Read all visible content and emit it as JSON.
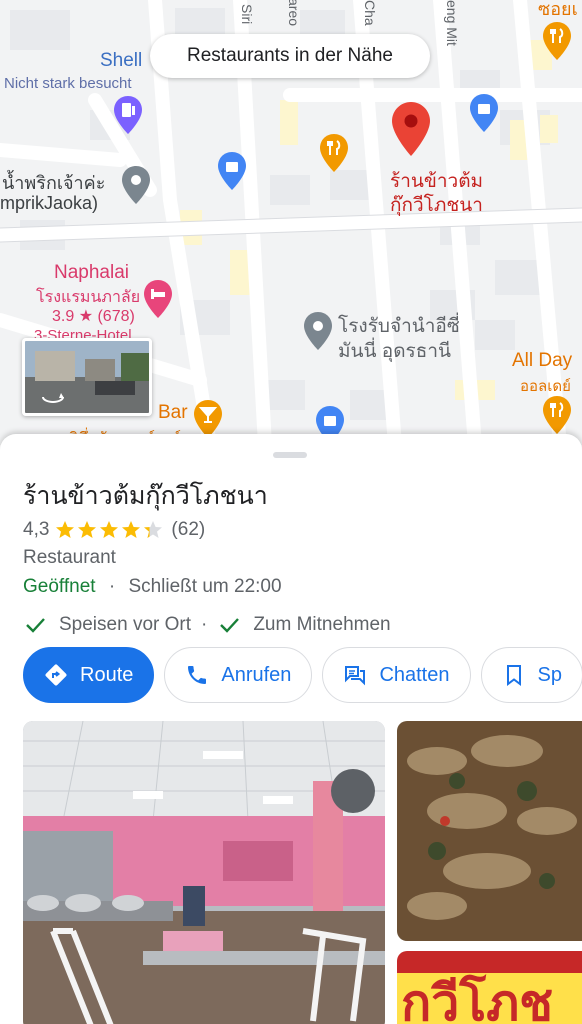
{
  "search": {
    "label": "Restaurants in der Nähe"
  },
  "map": {
    "streets": [
      "Siri",
      "areo",
      "Cha",
      "eng Mit"
    ],
    "labels": [
      {
        "key": "shell",
        "text": "Shell",
        "color": "#3b6fc2"
      },
      {
        "key": "busy",
        "text": "Nicht stark besucht",
        "color": "#5f6fa8"
      },
      {
        "key": "namprik1",
        "text": "น้ำพริกเจ้าค่ะ",
        "color": "#3c4043"
      },
      {
        "key": "namprik2",
        "text": "mprikJaoka)",
        "color": "#3c4043"
      },
      {
        "key": "selected1",
        "text": "ร้านข้าวต้ม",
        "color": "#c5221f"
      },
      {
        "key": "selected2",
        "text": "กุ๊กวีโภชนา",
        "color": "#c5221f"
      },
      {
        "key": "naphalai",
        "text": "Naphalai",
        "color": "#d93a6b"
      },
      {
        "key": "naphalaiThai",
        "text": "โรงแรมนภาลัย",
        "color": "#d93a6b"
      },
      {
        "key": "naphalaiRating",
        "text": "3.9 ★ (678)",
        "color": "#d93a6b"
      },
      {
        "key": "naphalaiStars",
        "text": "3-Sterne-Hotel",
        "color": "#d93a6b"
      },
      {
        "key": "pawn1",
        "text": "โรงรับจำนำอีซี่",
        "color": "#5f6368"
      },
      {
        "key": "pawn2",
        "text": "มันนี่ อุดรธานี",
        "color": "#5f6368"
      },
      {
        "key": "allday",
        "text": "All Day",
        "color": "#e37400"
      },
      {
        "key": "alldayThai",
        "text": "ออลเดย์",
        "color": "#e37400"
      },
      {
        "key": "bar",
        "text": "Bar",
        "color": "#e37400"
      },
      {
        "key": "barThai",
        "text": "ริทึ่มผับแอนด์บาร์",
        "color": "#e37400"
      },
      {
        "key": "topright",
        "text": "ซอยเ",
        "color": "#e37400"
      }
    ]
  },
  "place": {
    "title": "ร้านข้าวต้มกุ๊กวีโภชนา",
    "rating": "4,3",
    "stars": 4.3,
    "reviews": "(62)",
    "category": "Restaurant",
    "status": "Geöffnet",
    "separator": "·",
    "closes": "Schließt um 22:00",
    "services": [
      "Speisen vor Ort",
      "Zum Mitnehmen"
    ]
  },
  "actions": {
    "route": "Route",
    "call": "Anrufen",
    "chat": "Chatten",
    "save": "Sp"
  },
  "photos": {
    "side_text": "กวีโภช"
  },
  "colors": {
    "accent": "#1a73e8",
    "open": "#188038",
    "star": "#fbbc04",
    "pin": "#ea4335"
  }
}
